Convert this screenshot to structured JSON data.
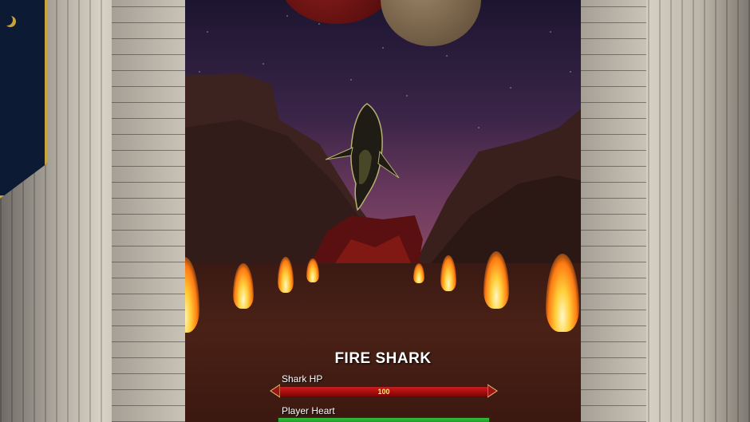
{
  "boss": {
    "name": "FIRE SHARK",
    "hp_label": "Shark HP",
    "hp_value": "100",
    "hp_fraction": 1.0,
    "hp_color": "#d81818"
  },
  "player": {
    "heart_label": "Player Heart",
    "heart_fraction": 1.0,
    "heart_color": "#2fbf3a"
  },
  "icons": {
    "boss_enemy": "shark-icon",
    "fire": "fire-icon",
    "banner_emblem": "moon-icon"
  }
}
